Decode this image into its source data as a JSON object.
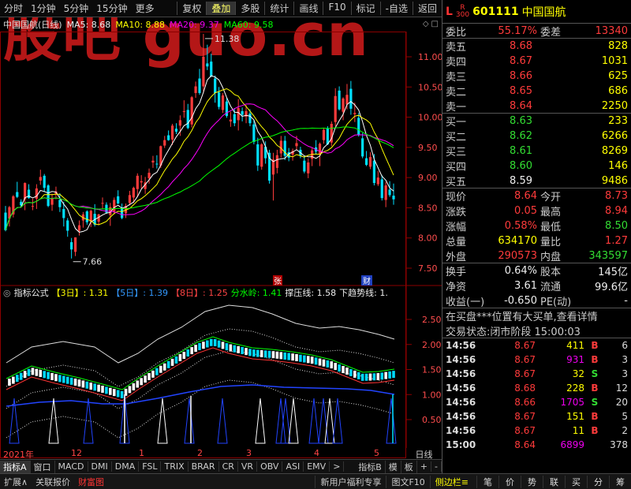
{
  "colors": {
    "up": "#ff3b3b",
    "down": "#00e0ff",
    "ma5": "#ffffff",
    "ma10": "#ffff00",
    "ma20": "#ff00ff",
    "ma60": "#00ff00",
    "dark": "#8b0000",
    "rhythm": "#ff66ff",
    "dim": "#666666"
  },
  "toolbar": {
    "items": [
      "分时",
      "1分钟",
      "5分钟",
      "15分钟",
      "更多"
    ],
    "buttons": [
      "复权",
      "叠加",
      "多股",
      "统计",
      "画线",
      "F10",
      "标记",
      "-自选",
      "返回"
    ]
  },
  "watermark": "股吧 guo.cn",
  "header": {
    "title": "中国国航(日线)",
    "ma5": "MA5: 8.68",
    "ma10": "MA10: 8.88",
    "ma20": "MA20: 9.37",
    "ma60": "MA60: 9.58"
  },
  "chart_data": {
    "type": "candlestick",
    "y_ticks": [
      "11.00",
      "10.50",
      "10.00",
      "9.50",
      "9.00",
      "8.50",
      "8.00",
      "7.50"
    ],
    "high_label": "11.38",
    "low_label": "7.66",
    "event_zhang": "张",
    "event_cai": "财",
    "ohlc": [
      [
        8.42,
        8.53,
        8.11,
        8.13
      ],
      [
        8.32,
        8.53,
        8.19,
        8.51
      ],
      [
        8.39,
        8.71,
        8.34,
        8.69
      ],
      [
        8.76,
        8.93,
        8.66,
        8.68
      ],
      [
        8.6,
        8.64,
        8.51,
        8.54
      ],
      [
        8.64,
        8.92,
        8.46,
        8.91
      ],
      [
        8.8,
        8.89,
        8.65,
        8.66
      ],
      [
        8.53,
        8.65,
        8.46,
        8.53
      ],
      [
        8.65,
        8.89,
        8.48,
        8.82
      ],
      [
        8.95,
        9.13,
        8.88,
        9.01
      ],
      [
        9.03,
        9.06,
        8.76,
        8.83
      ],
      [
        8.87,
        8.89,
        8.51,
        8.53
      ],
      [
        8.55,
        8.73,
        8.45,
        8.66
      ],
      [
        8.73,
        8.85,
        8.64,
        8.77
      ],
      [
        8.63,
        8.74,
        8.43,
        8.51
      ],
      [
        8.48,
        8.6,
        8.19,
        8.33
      ],
      [
        8.29,
        8.33,
        8.02,
        8.12
      ],
      [
        7.93,
        8.0,
        7.66,
        7.81
      ],
      [
        7.77,
        8.01,
        7.7,
        8.01
      ],
      [
        8.12,
        8.29,
        8.04,
        8.21
      ],
      [
        8.29,
        8.43,
        8.17,
        8.39
      ],
      [
        8.44,
        8.46,
        8.22,
        8.26
      ],
      [
        8.27,
        8.47,
        8.18,
        8.45
      ],
      [
        8.4,
        8.56,
        8.19,
        8.22
      ],
      [
        8.27,
        8.4,
        8.21,
        8.39
      ],
      [
        8.58,
        8.67,
        8.48,
        8.58
      ],
      [
        8.55,
        8.59,
        8.4,
        8.42
      ],
      [
        8.38,
        8.58,
        8.2,
        8.51
      ],
      [
        8.44,
        8.67,
        8.39,
        8.63
      ],
      [
        8.69,
        8.79,
        8.56,
        8.57
      ],
      [
        8.5,
        8.57,
        8.31,
        8.33
      ],
      [
        8.41,
        8.57,
        8.33,
        8.53
      ],
      [
        8.58,
        8.78,
        8.54,
        8.71
      ],
      [
        8.67,
        8.85,
        8.58,
        8.83
      ],
      [
        8.81,
        9.07,
        8.68,
        9.03
      ],
      [
        8.92,
        9.04,
        8.82,
        8.94
      ],
      [
        8.81,
        9.01,
        8.73,
        8.92
      ],
      [
        8.99,
        9.15,
        8.9,
        9.08
      ],
      [
        9.25,
        9.36,
        9.16,
        9.28
      ],
      [
        9.23,
        9.37,
        9.15,
        9.22
      ],
      [
        9.2,
        9.53,
        9.16,
        9.52
      ],
      [
        9.53,
        9.69,
        9.49,
        9.62
      ],
      [
        9.7,
        9.78,
        9.61,
        9.62
      ],
      [
        9.63,
        9.89,
        9.54,
        9.86
      ],
      [
        9.81,
        9.9,
        9.72,
        9.76
      ],
      [
        9.86,
        10.03,
        9.69,
        9.95
      ],
      [
        10.1,
        10.28,
        9.99,
        10.1
      ],
      [
        10.12,
        10.22,
        9.8,
        9.82
      ],
      [
        9.88,
        10.35,
        9.83,
        10.33
      ],
      [
        10.4,
        10.59,
        10.32,
        10.51
      ],
      [
        10.64,
        10.8,
        10.37,
        10.4
      ],
      [
        10.51,
        11.38,
        10.4,
        11.0
      ],
      [
        10.89,
        11.2,
        10.78,
        10.84
      ],
      [
        10.92,
        11.05,
        10.66,
        10.68
      ],
      [
        10.64,
        10.69,
        10.24,
        10.4
      ],
      [
        10.41,
        10.5,
        10.13,
        10.17
      ],
      [
        10.12,
        10.4,
        10.07,
        10.36
      ],
      [
        10.26,
        10.32,
        9.99,
        10.02
      ],
      [
        9.93,
        10.09,
        9.84,
        9.96
      ],
      [
        10.05,
        10.15,
        9.85,
        9.9
      ],
      [
        9.95,
        10.3,
        9.78,
        10.15
      ],
      [
        10.1,
        10.16,
        9.93,
        10.04
      ],
      [
        10.01,
        10.2,
        9.9,
        10.1
      ],
      [
        10.06,
        10.13,
        9.85,
        9.9
      ],
      [
        9.88,
        9.95,
        9.55,
        9.59
      ],
      [
        9.55,
        9.66,
        9.11,
        9.2
      ],
      [
        9.18,
        9.57,
        9.13,
        9.55
      ],
      [
        9.51,
        9.6,
        9.23,
        9.32
      ],
      [
        9.41,
        9.46,
        8.9,
        8.95
      ],
      [
        9.05,
        9.41,
        8.62,
        9.3
      ],
      [
        9.16,
        9.46,
        9.07,
        9.37
      ],
      [
        9.4,
        9.69,
        9.33,
        9.61
      ],
      [
        9.61,
        9.69,
        9.29,
        9.36
      ],
      [
        9.42,
        9.49,
        9.27,
        9.33
      ],
      [
        9.38,
        9.48,
        9.28,
        9.44
      ],
      [
        9.52,
        9.69,
        9.46,
        9.57
      ],
      [
        9.46,
        9.51,
        9.32,
        9.36
      ],
      [
        9.28,
        9.36,
        9.07,
        9.1
      ],
      [
        9.07,
        9.32,
        8.99,
        9.25
      ],
      [
        9.31,
        9.49,
        9.19,
        9.45
      ],
      [
        9.5,
        9.62,
        9.38,
        9.43
      ],
      [
        9.38,
        9.58,
        9.19,
        9.56
      ],
      [
        9.62,
        9.82,
        9.56,
        9.79
      ],
      [
        9.82,
        9.85,
        9.54,
        9.55
      ],
      [
        9.58,
        9.93,
        9.52,
        9.89
      ],
      [
        9.92,
        10.48,
        9.85,
        10.35
      ],
      [
        10.44,
        10.51,
        10.11,
        10.13
      ],
      [
        10.09,
        10.33,
        9.95,
        10.31
      ],
      [
        10.21,
        10.55,
        10.13,
        10.37
      ],
      [
        10.47,
        10.6,
        10.04,
        10.14
      ],
      [
        10.05,
        10.24,
        9.92,
        10.07
      ],
      [
        9.99,
        10.07,
        9.68,
        9.71
      ],
      [
        9.65,
        9.74,
        9.32,
        9.35
      ],
      [
        9.32,
        9.44,
        9.19,
        9.21
      ],
      [
        9.18,
        9.42,
        9.14,
        9.34
      ],
      [
        9.28,
        9.39,
        8.87,
        8.91
      ],
      [
        8.89,
        9.11,
        8.86,
        9.0
      ],
      [
        8.97,
        9.04,
        8.62,
        8.66
      ],
      [
        8.63,
        8.93,
        8.51,
        8.87
      ],
      [
        8.8,
        8.94,
        8.68,
        8.71
      ],
      [
        8.7,
        8.9,
        8.55,
        8.64
      ]
    ]
  },
  "indicator": {
    "name": "指标公式",
    "d3": "【3日】: 1.31",
    "d5": "【5日】: 1.39",
    "d8": "【8日】: 1.25",
    "water": "分水岭: 1.41",
    "support": "撑压线: 1.58",
    "trend": "下趋势线: 1.",
    "y_ticks": [
      "2.50",
      "2.00",
      "1.50",
      "1.00",
      "0.50"
    ],
    "band_points": [
      [
        8,
        460
      ],
      [
        40,
        440
      ],
      [
        80,
        433
      ],
      [
        120,
        440
      ],
      [
        150,
        460
      ],
      [
        175,
        448
      ],
      [
        200,
        430
      ],
      [
        230,
        415
      ],
      [
        260,
        395
      ],
      [
        290,
        387
      ],
      [
        320,
        390
      ],
      [
        345,
        398
      ],
      [
        375,
        410
      ],
      [
        405,
        416
      ],
      [
        430,
        414
      ],
      [
        455,
        418
      ],
      [
        480,
        424
      ],
      [
        500,
        430
      ]
    ],
    "ribbon_points": [
      [
        8,
        486
      ],
      [
        40,
        470
      ],
      [
        70,
        478
      ],
      [
        100,
        485
      ],
      [
        130,
        493
      ],
      [
        155,
        500
      ],
      [
        175,
        486
      ],
      [
        200,
        470
      ],
      [
        225,
        455
      ],
      [
        250,
        440
      ],
      [
        270,
        433
      ],
      [
        290,
        440
      ],
      [
        320,
        447
      ],
      [
        345,
        449
      ],
      [
        370,
        452
      ],
      [
        395,
        456
      ],
      [
        420,
        462
      ],
      [
        440,
        470
      ],
      [
        460,
        478
      ],
      [
        480,
        477
      ],
      [
        500,
        474
      ]
    ],
    "blue_points": [
      [
        8,
        515
      ],
      [
        50,
        510
      ],
      [
        90,
        508
      ],
      [
        130,
        512
      ],
      [
        160,
        512
      ],
      [
        200,
        505
      ],
      [
        240,
        497
      ],
      [
        280,
        490
      ],
      [
        320,
        488
      ],
      [
        360,
        491
      ],
      [
        400,
        492
      ],
      [
        440,
        493
      ],
      [
        470,
        495
      ],
      [
        500,
        500
      ]
    ]
  },
  "xaxis": {
    "year": "2021年",
    "m12": "12",
    "m1": "1",
    "m2": "2",
    "m3": "3",
    "m4": "4",
    "m5": "5",
    "dayline": "日线"
  },
  "tabs": [
    "指标A",
    "窗口",
    "MACD",
    "DMI",
    "DMA",
    "FSL",
    "TRIX",
    "BRAR",
    "CR",
    "VR",
    "OBV",
    "ASI",
    "EMV",
    ">"
  ],
  "tabs_right": [
    "指标B",
    "模",
    "板",
    "+",
    "-"
  ],
  "footer": {
    "ext": "扩展∧",
    "news": "关联报价",
    "fortune": "财富图",
    "promo": "新用户福利专享",
    "f10": "图文F10",
    "sidebar": "侧边栏≡",
    "nav": [
      "笔",
      "价",
      "势",
      "联",
      "买",
      "分",
      "筹"
    ]
  },
  "quote": {
    "L": "L",
    "R": "R",
    "r300": "300",
    "code": "601111",
    "name": "中国国航",
    "weibi_lbl": "委比",
    "weibi": "55.17%",
    "weicha_lbl": "委差",
    "weicha": "13340",
    "sells": [
      [
        "卖五",
        "8.68",
        "828"
      ],
      [
        "卖四",
        "8.67",
        "1031"
      ],
      [
        "卖三",
        "8.66",
        "625"
      ],
      [
        "卖二",
        "8.65",
        "686"
      ],
      [
        "卖一",
        "8.64",
        "2250"
      ]
    ],
    "buys": [
      [
        "买一",
        "8.63",
        "233"
      ],
      [
        "买二",
        "8.62",
        "6266"
      ],
      [
        "买三",
        "8.61",
        "8269"
      ],
      [
        "买四",
        "8.60",
        "146"
      ],
      [
        "买五",
        "8.59",
        "9486"
      ]
    ],
    "price_lbl": "现价",
    "price": "8.64",
    "open_lbl": "今开",
    "open": "8.73",
    "chg_lbl": "涨跌",
    "chg": "0.05",
    "high_lbl": "最高",
    "high": "8.94",
    "pct_lbl": "涨幅",
    "pct": "0.58%",
    "low_lbl": "最低",
    "low": "8.50",
    "vol_lbl": "总量",
    "vol": "634170",
    "vr_lbl": "量比",
    "vr": "1.27",
    "outer_lbl": "外盘",
    "outer": "290573",
    "inner_lbl": "内盘",
    "inner": "343597",
    "turn_lbl": "换手",
    "turn": "0.64%",
    "share_lbl": "股本",
    "share": "145亿",
    "nav_lbl": "净资",
    "nav": "3.61",
    "float_lbl": "流通",
    "float": "99.6亿",
    "eps_lbl": "收益(一)",
    "eps": "-0.650",
    "pe_lbl": "PE(动)",
    "pe": "-",
    "msg": "在买盘***位置有大买单,查看详情",
    "status": "交易状态:闭市阶段 15:00:03"
  },
  "ticks": [
    [
      "14:56",
      "8.67",
      "411",
      "B",
      "6"
    ],
    [
      "14:56",
      "8.67",
      "931",
      "B",
      "3"
    ],
    [
      "14:56",
      "8.67",
      "32",
      "S",
      "3"
    ],
    [
      "14:56",
      "8.68",
      "228",
      "B",
      "12"
    ],
    [
      "14:56",
      "8.66",
      "1705",
      "S",
      "20"
    ],
    [
      "14:56",
      "8.67",
      "151",
      "B",
      "5"
    ],
    [
      "14:56",
      "8.67",
      "11",
      "B",
      "2"
    ],
    [
      "15:00",
      "8.64",
      "6899",
      "",
      "378"
    ]
  ]
}
